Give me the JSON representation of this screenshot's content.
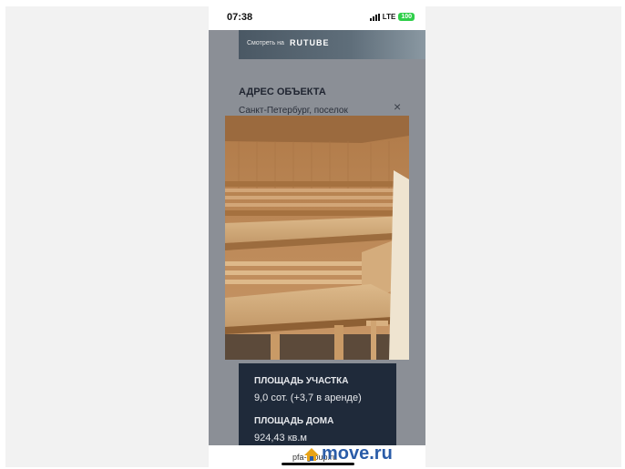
{
  "status_bar": {
    "time": "07:38",
    "network": "LTE",
    "battery": "100"
  },
  "video_banner": {
    "watch_on": "Смотреть на",
    "brand": "RUTUBE"
  },
  "address": {
    "title": "АДРЕС ОБЪЕКТА",
    "text": "Санкт-Петербург, поселок",
    "close": "×"
  },
  "photo": {
    "subject": "sauna-interior"
  },
  "stats": {
    "plot_area_label": "ПЛОЩАДЬ УЧАСТКА",
    "plot_area_value": "9,0 сот. (+3,7 в аренде)",
    "house_area_label": "ПЛОЩАДЬ ДОМА",
    "house_area_value": "924,43 кв.м"
  },
  "footer": {
    "site": "pfa-group.ru"
  },
  "watermark": {
    "brand": "move.ru"
  },
  "colors": {
    "page_overlay": "#8b8f96",
    "stats_bg": "#1f2a3a",
    "watermark": "#2a5ca8",
    "battery": "#2fcf4a"
  }
}
